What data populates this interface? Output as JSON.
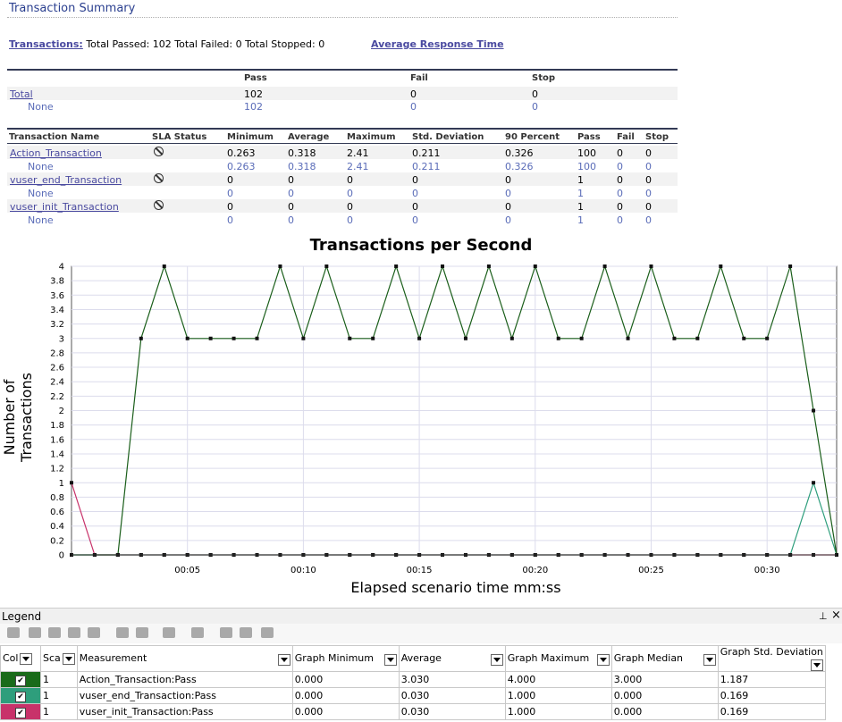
{
  "header": {
    "title": "Transaction Summary"
  },
  "summary": {
    "transactions_link": "Transactions:",
    "totals_text": "Total Passed: 102 Total Failed: 0 Total Stopped: 0",
    "avg_response_link": "Average Response Time"
  },
  "overall": {
    "columns": [
      "Pass",
      "Fail",
      "Stop"
    ],
    "total": {
      "label": "Total",
      "pass": "102",
      "fail": "0",
      "stop": "0"
    },
    "none": {
      "label": "None",
      "pass": "102",
      "fail": "0",
      "stop": "0"
    }
  },
  "detail": {
    "columns": [
      "Transaction Name",
      "SLA Status",
      "Minimum",
      "Average",
      "Maximum",
      "Std. Deviation",
      "90 Percent",
      "Pass",
      "Fail",
      "Stop"
    ],
    "rows": [
      {
        "name": "Action_Transaction",
        "min": "0.263",
        "avg": "0.318",
        "max": "2.41",
        "std": "0.211",
        "p90": "0.326",
        "pass": "100",
        "fail": "0",
        "stop": "0",
        "none": {
          "label": "None",
          "min": "0.263",
          "avg": "0.318",
          "max": "2.41",
          "std": "0.211",
          "p90": "0.326",
          "pass": "100",
          "fail": "0",
          "stop": "0"
        }
      },
      {
        "name": "vuser_end_Transaction",
        "min": "0",
        "avg": "0",
        "max": "0",
        "std": "0",
        "p90": "0",
        "pass": "1",
        "fail": "0",
        "stop": "0",
        "none": {
          "label": "None",
          "min": "0",
          "avg": "0",
          "max": "0",
          "std": "0",
          "p90": "0",
          "pass": "1",
          "fail": "0",
          "stop": "0"
        }
      },
      {
        "name": "vuser_init_Transaction",
        "min": "0",
        "avg": "0",
        "max": "0",
        "std": "0",
        "p90": "0",
        "pass": "1",
        "fail": "0",
        "stop": "0",
        "none": {
          "label": "None",
          "min": "0",
          "avg": "0",
          "max": "0",
          "std": "0",
          "p90": "0",
          "pass": "1",
          "fail": "0",
          "stop": "0"
        }
      }
    ]
  },
  "chart_data": {
    "type": "line",
    "title": "Transactions per Second",
    "xlabel": "Elapsed scenario time mm:ss",
    "ylabel": "Number of Transactions",
    "x": [
      0,
      1,
      2,
      3,
      4,
      5,
      6,
      7,
      8,
      9,
      10,
      11,
      12,
      13,
      14,
      15,
      16,
      17,
      18,
      19,
      20,
      21,
      22,
      23,
      24,
      25,
      26,
      27,
      28,
      29,
      30,
      31,
      32,
      33
    ],
    "x_ticks": [
      "00:05",
      "00:10",
      "00:15",
      "00:20",
      "00:25",
      "00:30"
    ],
    "ylim": [
      0,
      4
    ],
    "y_ticks": [
      "0",
      "0.2",
      "0.4",
      "0.6",
      "0.8",
      "1",
      "1.2",
      "1.4",
      "1.6",
      "1.8",
      "2",
      "2.2",
      "2.4",
      "2.6",
      "2.8",
      "3",
      "3.2",
      "3.4",
      "3.6",
      "3.8",
      "4"
    ],
    "grid": true,
    "series": [
      {
        "name": "Action_Transaction:Pass",
        "color": "#1a5e1a",
        "values": [
          0,
          0,
          0,
          3,
          4,
          3,
          3,
          3,
          3,
          4,
          3,
          4,
          3,
          3,
          4,
          3,
          4,
          3,
          4,
          3,
          4,
          3,
          3,
          4,
          3,
          4,
          3,
          3,
          4,
          3,
          3,
          4,
          2,
          0
        ]
      },
      {
        "name": "vuser_end_Transaction:Pass",
        "color": "#2e9e7c",
        "values": [
          0,
          0,
          0,
          0,
          0,
          0,
          0,
          0,
          0,
          0,
          0,
          0,
          0,
          0,
          0,
          0,
          0,
          0,
          0,
          0,
          0,
          0,
          0,
          0,
          0,
          0,
          0,
          0,
          0,
          0,
          0,
          0,
          1,
          0
        ]
      },
      {
        "name": "vuser_init_Transaction:Pass",
        "color": "#c8326a",
        "values": [
          1,
          0,
          0,
          0,
          0,
          0,
          0,
          0,
          0,
          0,
          0,
          0,
          0,
          0,
          0,
          0,
          0,
          0,
          0,
          0,
          0,
          0,
          0,
          0,
          0,
          0,
          0,
          0,
          0,
          0,
          0,
          0,
          0,
          0
        ]
      }
    ]
  },
  "legend": {
    "title": "Legend",
    "columns": [
      "Col",
      "Sca",
      "Measurement",
      "Graph Minimum",
      "Average",
      "Graph Maximum",
      "Graph Median",
      "Graph Std. Deviation"
    ],
    "rows": [
      {
        "color": "#1a6b1a",
        "scale": "1",
        "measurement": "Action_Transaction:Pass",
        "min": "0.000",
        "avg": "3.030",
        "max": "4.000",
        "median": "3.000",
        "std": "1.187"
      },
      {
        "color": "#2e9e7c",
        "scale": "1",
        "measurement": "vuser_end_Transaction:Pass",
        "min": "0.000",
        "avg": "0.030",
        "max": "1.000",
        "median": "0.000",
        "std": "0.169"
      },
      {
        "color": "#c8326a",
        "scale": "1",
        "measurement": "vuser_init_Transaction:Pass",
        "min": "0.000",
        "avg": "0.030",
        "max": "1.000",
        "median": "0.000",
        "std": "0.169"
      }
    ]
  }
}
